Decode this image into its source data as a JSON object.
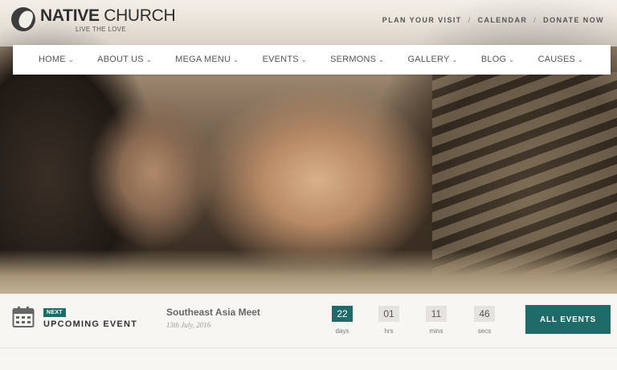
{
  "header": {
    "logo_bold": "NATIVE",
    "logo_light": "CHURCH",
    "tagline": "LIVE THE LOVE",
    "toplinks": [
      "PLAN YOUR VISIT",
      "CALENDAR",
      "DONATE NOW"
    ],
    "separator": "/"
  },
  "nav": {
    "items": [
      "HOME",
      "ABOUT US",
      "MEGA MENU",
      "EVENTS",
      "SERMONS",
      "GALLERY",
      "BLOG",
      "CAUSES"
    ],
    "chevron": "⌄"
  },
  "events": {
    "badge": "NEXT",
    "label": "UPCOMING EVENT",
    "title": "Southeast Asia Meet",
    "date": "13th July, 2016",
    "countdown": {
      "days": {
        "value": "22",
        "label": "days"
      },
      "hrs": {
        "value": "01",
        "label": "hrs"
      },
      "mins": {
        "value": "11",
        "label": "mins"
      },
      "secs": {
        "value": "46",
        "label": "secs"
      }
    },
    "button": "ALL EVENTS"
  },
  "colors": {
    "accent": "#1e6b6a"
  },
  "icons": {
    "logo": "church-logo-icon",
    "calendar": "calendar-icon"
  }
}
